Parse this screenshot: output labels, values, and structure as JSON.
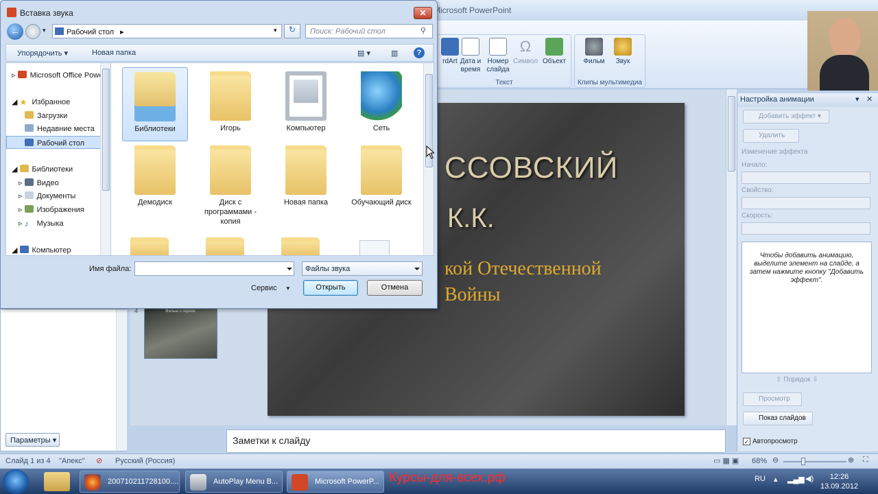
{
  "ppt": {
    "title": "Microsoft PowerPoint",
    "ribbon": {
      "groups": [
        {
          "label": "Текст",
          "buttons": [
            "rdArt",
            "Дата и время",
            "Номер слайда",
            "Символ",
            "Объект"
          ]
        },
        {
          "label": "Клипы мультимедиа",
          "buttons": [
            "Фильм",
            "Звук"
          ]
        }
      ]
    },
    "slide": {
      "line1": "ССОВСКИЙ",
      "line2": "К.К.",
      "line3": "кой Отечественной",
      "line4": "Войны"
    },
    "thumb_number": "4",
    "thumb_caption": "Фильм о героях",
    "params_button": "Параметры",
    "notes_placeholder": "Заметки к слайду",
    "anim_pane": {
      "title": "Настройка анимации",
      "add_effect": "Добавить эффект",
      "delete": "Удалить",
      "change_effect": "Изменение эффекта",
      "start": "Начало:",
      "property": "Свойство:",
      "speed": "Скорость:",
      "hint": "Чтобы добавить анимацию, выделите элемент на слайде, а затем нажмите кнопку \"Добавить эффект\".",
      "order": "Порядок",
      "preview": "Просмотр",
      "slideshow": "Показ слайдов",
      "autopreview": "Автопросмотр"
    },
    "status": {
      "slide": "Слайд 1 из 4",
      "theme": "\"Апекс\"",
      "language": "Русский (Россия)",
      "zoom": "68%"
    }
  },
  "dialog": {
    "title": "Вставка звука",
    "address": "Рабочий стол",
    "search_placeholder": "Поиск: Рабочий стол",
    "toolbar": {
      "organize": "Упорядочить",
      "new_folder": "Новая папка"
    },
    "nav": [
      {
        "label": "Microsoft Office PowerPoint",
        "icon": "office-icon"
      },
      {
        "label": "Избранное",
        "icon": "star-icon"
      },
      {
        "label": "Загрузки",
        "icon": "downloads-icon"
      },
      {
        "label": "Недавние места",
        "icon": "recent-icon"
      },
      {
        "label": "Рабочий стол",
        "icon": "desktop-icon"
      },
      {
        "label": "Библиотеки",
        "icon": "libraries-icon"
      },
      {
        "label": "Видео",
        "icon": "video-icon"
      },
      {
        "label": "Документы",
        "icon": "documents-icon"
      },
      {
        "label": "Изображения",
        "icon": "images-icon"
      },
      {
        "label": "Музыка",
        "icon": "music-icon"
      },
      {
        "label": "Компьютер",
        "icon": "computer-icon"
      }
    ],
    "files": [
      {
        "label": "Библиотеки",
        "icon": "libraries-icon"
      },
      {
        "label": "Игорь",
        "icon": "user-folder-icon"
      },
      {
        "label": "Компьютер",
        "icon": "computer-icon"
      },
      {
        "label": "Сеть",
        "icon": "network-icon"
      },
      {
        "label": "Демодиск",
        "icon": "folder-icon"
      },
      {
        "label": "Диск с программами - копия",
        "icon": "folder-icon"
      },
      {
        "label": "Новая папка",
        "icon": "folder-icon"
      },
      {
        "label": "Обучающий диск",
        "icon": "folder-icon"
      }
    ],
    "filename_label": "Имя файла:",
    "filename_value": "",
    "filetype": "Файлы звука",
    "service": "Сервис",
    "open": "Открыть",
    "cancel": "Отмена"
  },
  "taskbar": {
    "items": [
      "200710211728100....",
      "AutoPlay Menu B...",
      "Microsoft PowerP..."
    ],
    "brand": "Курсы-для-всех.рф",
    "lang": "RU",
    "time": "12:26",
    "date": "13.09.2012"
  }
}
